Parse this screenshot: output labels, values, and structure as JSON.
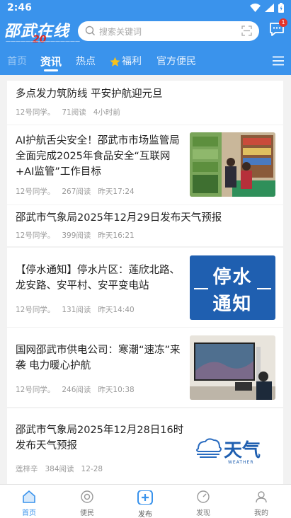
{
  "status": {
    "time": "2:46"
  },
  "header": {
    "logo_text": "邵武在线",
    "logo_badge": "20",
    "search_placeholder": "搜索关键词",
    "message_count": "1"
  },
  "tabs": [
    {
      "label": "首页"
    },
    {
      "label": "资讯"
    },
    {
      "label": "热点"
    },
    {
      "label": "福利"
    },
    {
      "label": "官方便民"
    }
  ],
  "feed": [
    {
      "title": "多点发力筑防线 平安护航迎元旦",
      "author": "12号同学。",
      "reads": "71阅读",
      "time": "4小时前"
    },
    {
      "title": "AI护航舌尖安全！邵武市市场监管局全面完成2025年食品安全“互联网+AI监管”工作目标",
      "author": "12号同学。",
      "reads": "267阅读",
      "time": "昨天17:24"
    },
    {
      "title": "邵武市气象局2025年12月29日发布天气预报",
      "author": "12号同学。",
      "reads": "399阅读",
      "time": "昨天16:21"
    },
    {
      "title": "【停水通知】停水片区：莲欣北路、龙安路、安平村、安平变电站",
      "author": "12号同学。",
      "reads": "131阅读",
      "time": "昨天14:40",
      "thumb_line1": "停水",
      "thumb_line2": "通知"
    },
    {
      "title": "国网邵武市供电公司：寒潮“速冻”来袭 电力暖心护航",
      "author": "12号同学。",
      "reads": "246阅读",
      "time": "昨天10:38"
    },
    {
      "title": "邵武市气象局2025年12月28日16时发布天气预报",
      "author": "莲梓辛",
      "reads": "384阅读",
      "time": "12-28",
      "thumb_text": "天气",
      "thumb_sub": "WEATHER"
    }
  ],
  "bottom_nav": [
    {
      "label": "首页"
    },
    {
      "label": "便民"
    },
    {
      "label": "发布"
    },
    {
      "label": "发现"
    },
    {
      "label": "我的"
    }
  ],
  "colors": {
    "brand": "#3a93ec",
    "badge": "#e5332a"
  }
}
